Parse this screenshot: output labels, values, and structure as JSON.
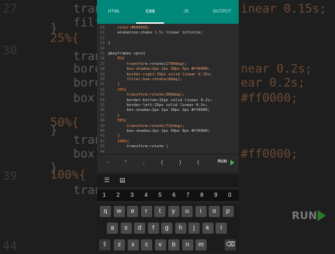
{
  "background": {
    "line_numbers": [
      "27",
      "",
      "",
      "30",
      "",
      "",
      "",
      "",
      "",
      "",
      "",
      "",
      "39",
      "",
      "",
      "",
      "",
      "44"
    ],
    "fragments": [
      {
        "text": "trans",
        "o": false
      },
      {
        "text": "filt",
        "o": false
      },
      {
        "text": "}",
        "o": false
      },
      {
        "text": "25%{",
        "o": true
      },
      {
        "text": "tran",
        "o": false
      },
      {
        "text": "bord",
        "o": false
      },
      {
        "text": "bord",
        "o": false
      },
      {
        "text": "box-",
        "o": false
      },
      {
        "text": "}",
        "o": false
      },
      {
        "text": "50%{",
        "o": true
      },
      {
        "text": "tran",
        "o": false
      },
      {
        "text": "box-",
        "o": false
      },
      {
        "text": "}",
        "o": false
      },
      {
        "text": "100%{",
        "o": true
      },
      {
        "text": "tran",
        "o": false
      }
    ],
    "right_fragments": [
      "inear 0.15s;",
      "near 0.2s;",
      "ear 0.2s;",
      "#ff0000;",
      "#ff0000;"
    ],
    "run_label": "RUN"
  },
  "tabs": {
    "html": "HTML",
    "css": "CSS",
    "js": "JS",
    "output": "OUTPUT"
  },
  "editor": {
    "lines": [
      {
        "n": "20",
        "parts": [
          [
            "v",
            "    color:#999999;"
          ]
        ]
      },
      {
        "n": "21",
        "parts": [
          [
            "p",
            "    animation:shake "
          ],
          [
            "v",
            "1.5s"
          ],
          [
            "p",
            " linear infinite;"
          ]
        ]
      },
      {
        "n": "22",
        "parts": [
          [
            "p",
            ""
          ]
        ]
      },
      {
        "n": "23",
        "parts": [
          [
            "p",
            "}"
          ]
        ]
      },
      {
        "n": "24",
        "parts": [
          [
            "p",
            ""
          ]
        ]
      },
      {
        "n": "25",
        "parts": [
          [
            "p",
            "@keyframes spin{"
          ]
        ]
      },
      {
        "n": "26",
        "parts": [
          [
            "k",
            "    0%{"
          ]
        ]
      },
      {
        "n": "27",
        "parts": [
          [
            "v",
            "        transform:"
          ],
          [
            "p",
            "rotate("
          ],
          [
            "v",
            "2700deg"
          ],
          [
            "p",
            ");"
          ]
        ]
      },
      {
        "n": "28",
        "parts": [
          [
            "v",
            "        box-shadow:2px 2px 30px 5px #ff0000;"
          ]
        ]
      },
      {
        "n": "29",
        "parts": [
          [
            "v",
            "        border-right:15px solid linear 0.15s;"
          ]
        ]
      },
      {
        "n": "30",
        "parts": [
          [
            "v",
            "        filter:hue-rotate(0deg);"
          ]
        ]
      },
      {
        "n": "31",
        "parts": [
          [
            "k",
            "    }"
          ]
        ]
      },
      {
        "n": "32",
        "parts": [
          [
            "k",
            "    25%{"
          ]
        ]
      },
      {
        "n": "33",
        "parts": [
          [
            "v",
            "        transform:rotate(360deg);"
          ]
        ]
      },
      {
        "n": "34",
        "parts": [
          [
            "p",
            "        border-bottom:15px solid linear 0.2s;"
          ]
        ]
      },
      {
        "n": "35",
        "parts": [
          [
            "p",
            "        border-left:15px solid linear 0.2s;"
          ]
        ]
      },
      {
        "n": "36",
        "parts": [
          [
            "p",
            "        box-shadow:2px 2px 30px 2px #ff0000;"
          ]
        ]
      },
      {
        "n": "37",
        "parts": [
          [
            "k",
            "    }"
          ]
        ]
      },
      {
        "n": "38",
        "parts": [
          [
            "k",
            "    50%{"
          ]
        ]
      },
      {
        "n": "39",
        "parts": [
          [
            "v",
            "        transform:rotate(715deg);"
          ]
        ]
      },
      {
        "n": "40",
        "parts": [
          [
            "p",
            "        box-shadow:2px 2px 50px 9px #ff0000;"
          ]
        ]
      },
      {
        "n": "41",
        "parts": [
          [
            "k",
            "    }"
          ]
        ]
      },
      {
        "n": "42",
        "parts": [
          [
            "k",
            "    100%{"
          ]
        ]
      },
      {
        "n": "43",
        "parts": [
          [
            "p",
            "        transform:rotate "
          ],
          [
            "sel",
            "|"
          ]
        ]
      },
      {
        "n": "44",
        "parts": [
          [
            "p",
            ""
          ]
        ]
      }
    ]
  },
  "symbols": [
    "-",
    "\"",
    ";",
    "(",
    ")",
    "("
  ],
  "run_label": "RUN",
  "number_row": [
    "1",
    "2",
    "3",
    "4",
    "5",
    "6",
    "7",
    "8",
    "9",
    "0"
  ],
  "keyboard": {
    "row1": [
      "q",
      "w",
      "e",
      "r",
      "t",
      "y",
      "u",
      "i",
      "o",
      "p"
    ],
    "row2": [
      "a",
      "s",
      "d",
      "f",
      "g",
      "h",
      "j",
      "k",
      "l"
    ],
    "row3": [
      "z",
      "x",
      "c",
      "v",
      "b",
      "n",
      "m"
    ]
  }
}
